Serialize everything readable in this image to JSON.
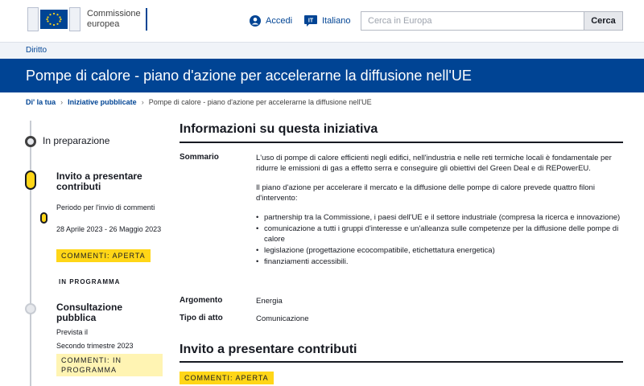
{
  "header": {
    "logo_line1": "Commissione",
    "logo_line2": "europea",
    "login_label": "Accedi",
    "language_code": "IT",
    "language_label": "Italiano",
    "search_placeholder": "Cerca in Europa",
    "search_button": "Cerca"
  },
  "sitebar": {
    "label": "Diritto"
  },
  "banner": {
    "title": "Pompe di calore - piano d'azione per accelerarne la diffusione nell'UE"
  },
  "breadcrumb": {
    "items": [
      "Di' la tua",
      "Iniziative pubblicate"
    ],
    "current": "Pompe di calore - piano d'azione per accelerarne la diffusione nell'UE"
  },
  "timeline": {
    "stage1": "In preparazione",
    "stage2": "Invito a presentare contributi",
    "stage2_period_label": "Periodo per l'invio di commenti",
    "stage2_dates": "28 Aprile 2023 - 26 Maggio 2023",
    "stage2_tag": "COMMENTI: APERTA",
    "section_label": "IN PROGRAMMA",
    "stage3": "Consultazione pubblica",
    "stage3_planned_label": "Prevista il",
    "stage3_date": "Secondo trimestre 2023",
    "stage3_tag": "COMMENTI: IN PROGRAMMA"
  },
  "info": {
    "heading": "Informazioni su questa iniziativa",
    "summary_label": "Sommario",
    "summary_p1": "L'uso di pompe di calore efficienti negli edifici, nell'industria e nelle reti termiche locali è fondamentale per ridurre le emissioni di gas a effetto serra e conseguire gli obiettivi del Green Deal e di REPowerEU.",
    "summary_p2": "Il piano d'azione per accelerare il mercato e la diffusione delle pompe di calore prevede quattro filoni d'intervento:",
    "bullets": [
      "partnership tra la Commissione, i paesi dell'UE e il settore industriale (compresa la ricerca e innovazione)",
      "comunicazione a tutti i gruppi d'interesse e un'alleanza sulle competenze per la diffusione delle pompe di calore",
      "legislazione (progettazione ecocompatibile, etichettatura energetica)",
      "finanziamenti accessibili."
    ],
    "topic_label": "Argomento",
    "topic_value": "Energia",
    "act_label": "Tipo di atto",
    "act_value": "Comunicazione"
  },
  "feedback": {
    "heading": "Invito a presentare contributi",
    "tag": "COMMENTI: APERTA"
  },
  "colors": {
    "ec_blue": "#004494",
    "tag_yellow": "#ffd617",
    "tag_yellow_light": "#fff4b3"
  }
}
